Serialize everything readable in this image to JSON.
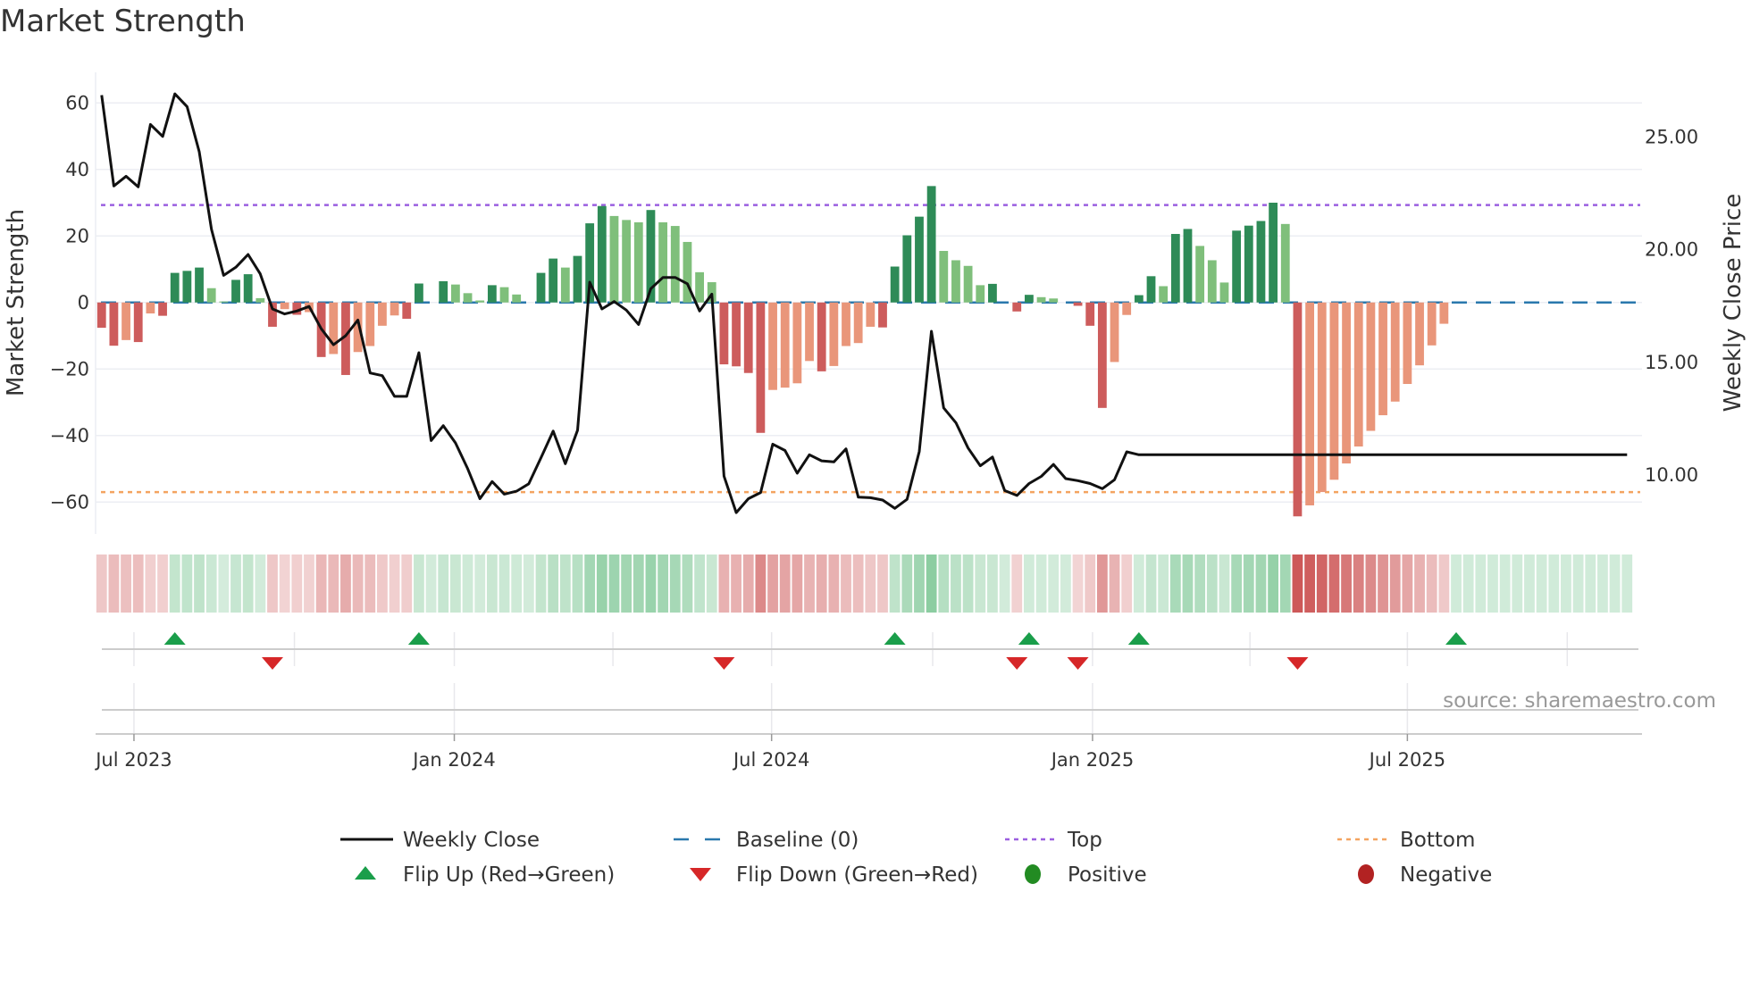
{
  "chart_data": {
    "type": "bar",
    "title": "Market Strength",
    "left_axis": {
      "label": "Market Strength",
      "ylim": [
        -70,
        70
      ],
      "ticks": [
        -60,
        -40,
        -20,
        0,
        20,
        40,
        60
      ],
      "tick_labels": [
        "−60",
        "−40",
        "−20",
        "0",
        "20",
        "40",
        "60"
      ],
      "grid": true
    },
    "right_axis": {
      "label": "Weekly Close Price",
      "ylim": [
        7.4,
        27.8
      ],
      "ticks": [
        10,
        15,
        20,
        25
      ],
      "tick_labels": [
        "10.00",
        "15.00",
        "20.00",
        "25.00"
      ]
    },
    "x_unit": "week index (weekly, starting mid-June 2023)",
    "x_ticks": [
      {
        "label": "Jul 2023",
        "week": 2.65
      },
      {
        "label": "Jan 2024",
        "week": 28.9
      },
      {
        "label": "Jul 2024",
        "week": 54.9
      },
      {
        "label": "Jan 2025",
        "week": 81.2
      },
      {
        "label": "Jul 2025",
        "week": 107.0
      }
    ],
    "minor_x_ticks": [
      15.8,
      41.9,
      68.1,
      94.1,
      120.1
    ],
    "weeks_total": 126,
    "strength": [
      -7.6,
      -13,
      -11.3,
      -11.9,
      -3.3,
      -4,
      8.9,
      9.5,
      10.5,
      4.3,
      0.3,
      6.8,
      8.5,
      1.3,
      -7.3,
      -2,
      -3.7,
      -2.9,
      -16.4,
      -15.5,
      -21.8,
      -14.9,
      -13.1,
      -7,
      -3.9,
      -4.9,
      5.7,
      0,
      6.4,
      5.4,
      2.8,
      0.6,
      5.2,
      4.6,
      2.4,
      0,
      8.9,
      13.2,
      10.5,
      14,
      23.8,
      29,
      26,
      24.8,
      24.1,
      27.8,
      24.1,
      23,
      18.2,
      9.1,
      6.1,
      -18.6,
      -19.2,
      -21.2,
      -39.2,
      -26.3,
      -25.6,
      -24.3,
      -17.6,
      -20.7,
      -19.1,
      -13.1,
      -12.2,
      -7.3,
      -7.5,
      10.8,
      20.2,
      25.8,
      35,
      15.5,
      12.7,
      11,
      5.2,
      5.6,
      0,
      -2.7,
      2.3,
      1.6,
      1.2,
      0,
      -1,
      -7,
      -31.7,
      -17.9,
      -3.75,
      2.2,
      7.9,
      4.9,
      20.6,
      22.1,
      17,
      12.7,
      6,
      21.6,
      23.1,
      24.5,
      30,
      23.6,
      -64.3,
      -61,
      -57,
      -53.3,
      -48.4,
      -43.3,
      -38.6,
      -33.9,
      -29.8,
      -24.5,
      -18.9,
      -12.9,
      -6.4
    ],
    "strength_strong": [
      1,
      1,
      0,
      1,
      0,
      1,
      1,
      1,
      1,
      0,
      0,
      1,
      1,
      0,
      1,
      0,
      1,
      0,
      1,
      0,
      1,
      0,
      0,
      0,
      0,
      1,
      1,
      0,
      1,
      0,
      0,
      0,
      1,
      0,
      0,
      0,
      1,
      1,
      0,
      1,
      1,
      1,
      0,
      0,
      0,
      1,
      0,
      0,
      0,
      0,
      0,
      1,
      1,
      1,
      1,
      0,
      0,
      0,
      0,
      1,
      0,
      0,
      0,
      0,
      1,
      1,
      1,
      1,
      1,
      0,
      0,
      0,
      0,
      1,
      0,
      1,
      1,
      0,
      0,
      0,
      1,
      1,
      1,
      0,
      0,
      1,
      1,
      0,
      1,
      1,
      0,
      0,
      0,
      1,
      1,
      1,
      1,
      0,
      1,
      0,
      0,
      0,
      0,
      0,
      0,
      0,
      0,
      0,
      0,
      0,
      0
    ],
    "close": [
      26.82,
      22.79,
      23.22,
      22.75,
      25.52,
      24.99,
      26.88,
      26.31,
      24.31,
      20.87,
      18.82,
      19.18,
      19.75,
      18.89,
      17.33,
      17.11,
      17.24,
      17.44,
      16.45,
      15.74,
      16.14,
      16.84,
      14.49,
      14.37,
      13.45,
      13.45,
      15.39,
      11.49,
      12.15,
      11.38,
      10.24,
      8.91,
      9.67,
      9.11,
      9.24,
      9.57,
      10.72,
      11.91,
      10.46,
      11.95,
      18.52,
      17.33,
      17.66,
      17.28,
      16.64,
      18.23,
      18.73,
      18.73,
      18.45,
      17.24,
      17.99,
      9.91,
      8.29,
      8.91,
      9.18,
      11.33,
      11.05,
      10.04,
      10.86,
      10.59,
      10.54,
      11.12,
      8.98,
      8.95,
      8.85,
      8.48,
      8.88,
      11.0,
      16.34,
      12.94,
      12.28,
      11.16,
      10.37,
      10.76,
      9.27,
      9.05,
      9.58,
      9.9,
      10.43,
      9.8,
      9.71,
      9.58,
      9.35,
      9.75,
      10.99,
      10.86,
      10.86,
      10.86,
      10.86,
      10.86,
      10.86,
      10.86,
      10.86,
      10.86,
      10.86,
      10.86,
      10.86,
      10.86,
      10.86,
      10.86,
      10.86,
      10.86,
      10.86,
      10.86,
      10.86,
      10.86,
      10.86,
      10.86,
      10.86,
      10.86,
      10.86,
      10.86,
      10.86,
      10.86,
      10.86,
      10.86,
      10.86,
      10.86,
      10.86,
      10.86,
      10.86,
      10.86,
      10.86,
      10.86,
      10.86,
      10.86
    ],
    "baseline": 0,
    "top_level": 29.3,
    "bottom_level": -57,
    "flip_up_weeks": [
      6,
      26,
      65,
      76,
      85,
      111
    ],
    "flip_down_weeks": [
      14,
      51,
      75,
      80,
      98
    ],
    "legend": {
      "placement": "bottom",
      "entries": [
        {
          "label": "Weekly Close",
          "kind": "line"
        },
        {
          "label": "Baseline (0)",
          "kind": "dash"
        },
        {
          "label": "Top",
          "kind": "dot-purple"
        },
        {
          "label": "Bottom",
          "kind": "dot-orange"
        },
        {
          "label": "Flip Up (Red→Green)",
          "kind": "tri-up"
        },
        {
          "label": "Flip Down (Green→Red)",
          "kind": "tri-down"
        },
        {
          "label": "Positive",
          "kind": "circle-green"
        },
        {
          "label": "Negative",
          "kind": "circle-red"
        }
      ]
    },
    "source": "source: sharemaestro.com"
  },
  "colors": {
    "pos_strong": "#2e8b57",
    "pos_weak": "#7fbf7b",
    "neg_strong": "#cd5c5c",
    "neg_weak": "#e9967a",
    "close": "#111111",
    "baseline": "#2a78ad",
    "top": "#9b5fe0",
    "bottom": "#f4a460",
    "flip_up": "#1a9e4a",
    "flip_down": "#d62728",
    "positive": "#228b22",
    "negative": "#b22222",
    "grid": "#eceef3",
    "axis": "#cccccc"
  }
}
